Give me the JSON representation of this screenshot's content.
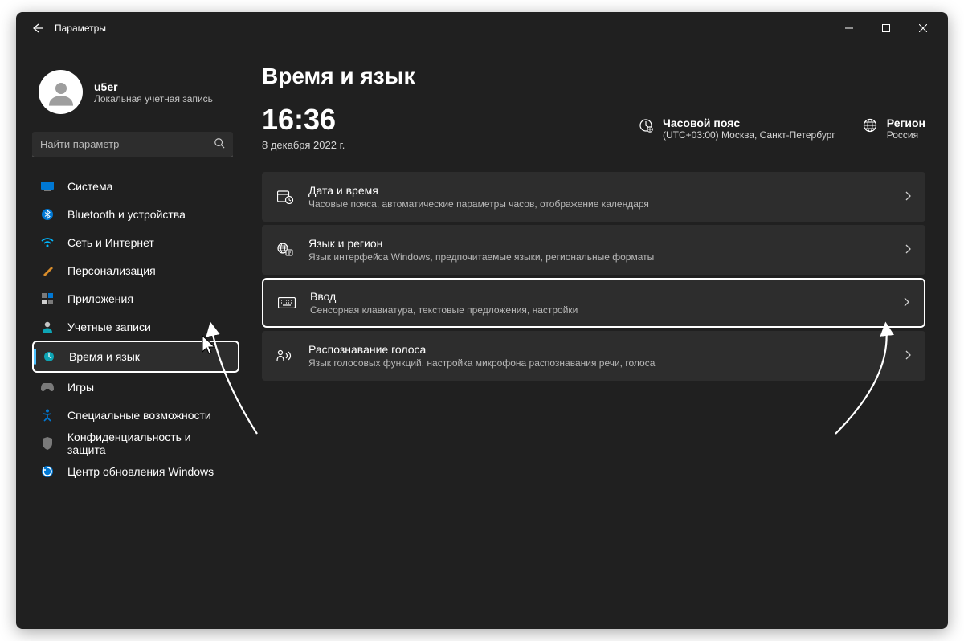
{
  "window": {
    "title": "Параметры"
  },
  "user": {
    "name": "u5er",
    "subtitle": "Локальная учетная запись"
  },
  "search": {
    "placeholder": "Найти параметр"
  },
  "nav": {
    "items": [
      {
        "label": "Система"
      },
      {
        "label": "Bluetooth и устройства"
      },
      {
        "label": "Сеть и Интернет"
      },
      {
        "label": "Персонализация"
      },
      {
        "label": "Приложения"
      },
      {
        "label": "Учетные записи"
      },
      {
        "label": "Время и язык"
      },
      {
        "label": "Игры"
      },
      {
        "label": "Специальные возможности"
      },
      {
        "label": "Конфиденциальность и защита"
      },
      {
        "label": "Центр обновления Windows"
      }
    ]
  },
  "page": {
    "title": "Время и язык",
    "time": "16:36",
    "date": "8 декабря 2022 г.",
    "timezone_label": "Часовой пояс",
    "timezone_value": "(UTC+03:00) Москва, Санкт-Петербург",
    "region_label": "Регион",
    "region_value": "Россия"
  },
  "cards": [
    {
      "title": "Дата и время",
      "sub": "Часовые пояса, автоматические параметры часов, отображение календаря"
    },
    {
      "title": "Язык и регион",
      "sub": "Язык интерфейса Windows, предпочитаемые языки, региональные форматы"
    },
    {
      "title": "Ввод",
      "sub": "Сенсорная клавиатура, текстовые предложения, настройки"
    },
    {
      "title": "Распознавание голоса",
      "sub": "Язык голосовых функций, настройка микрофона распознавания речи, голоса"
    }
  ]
}
